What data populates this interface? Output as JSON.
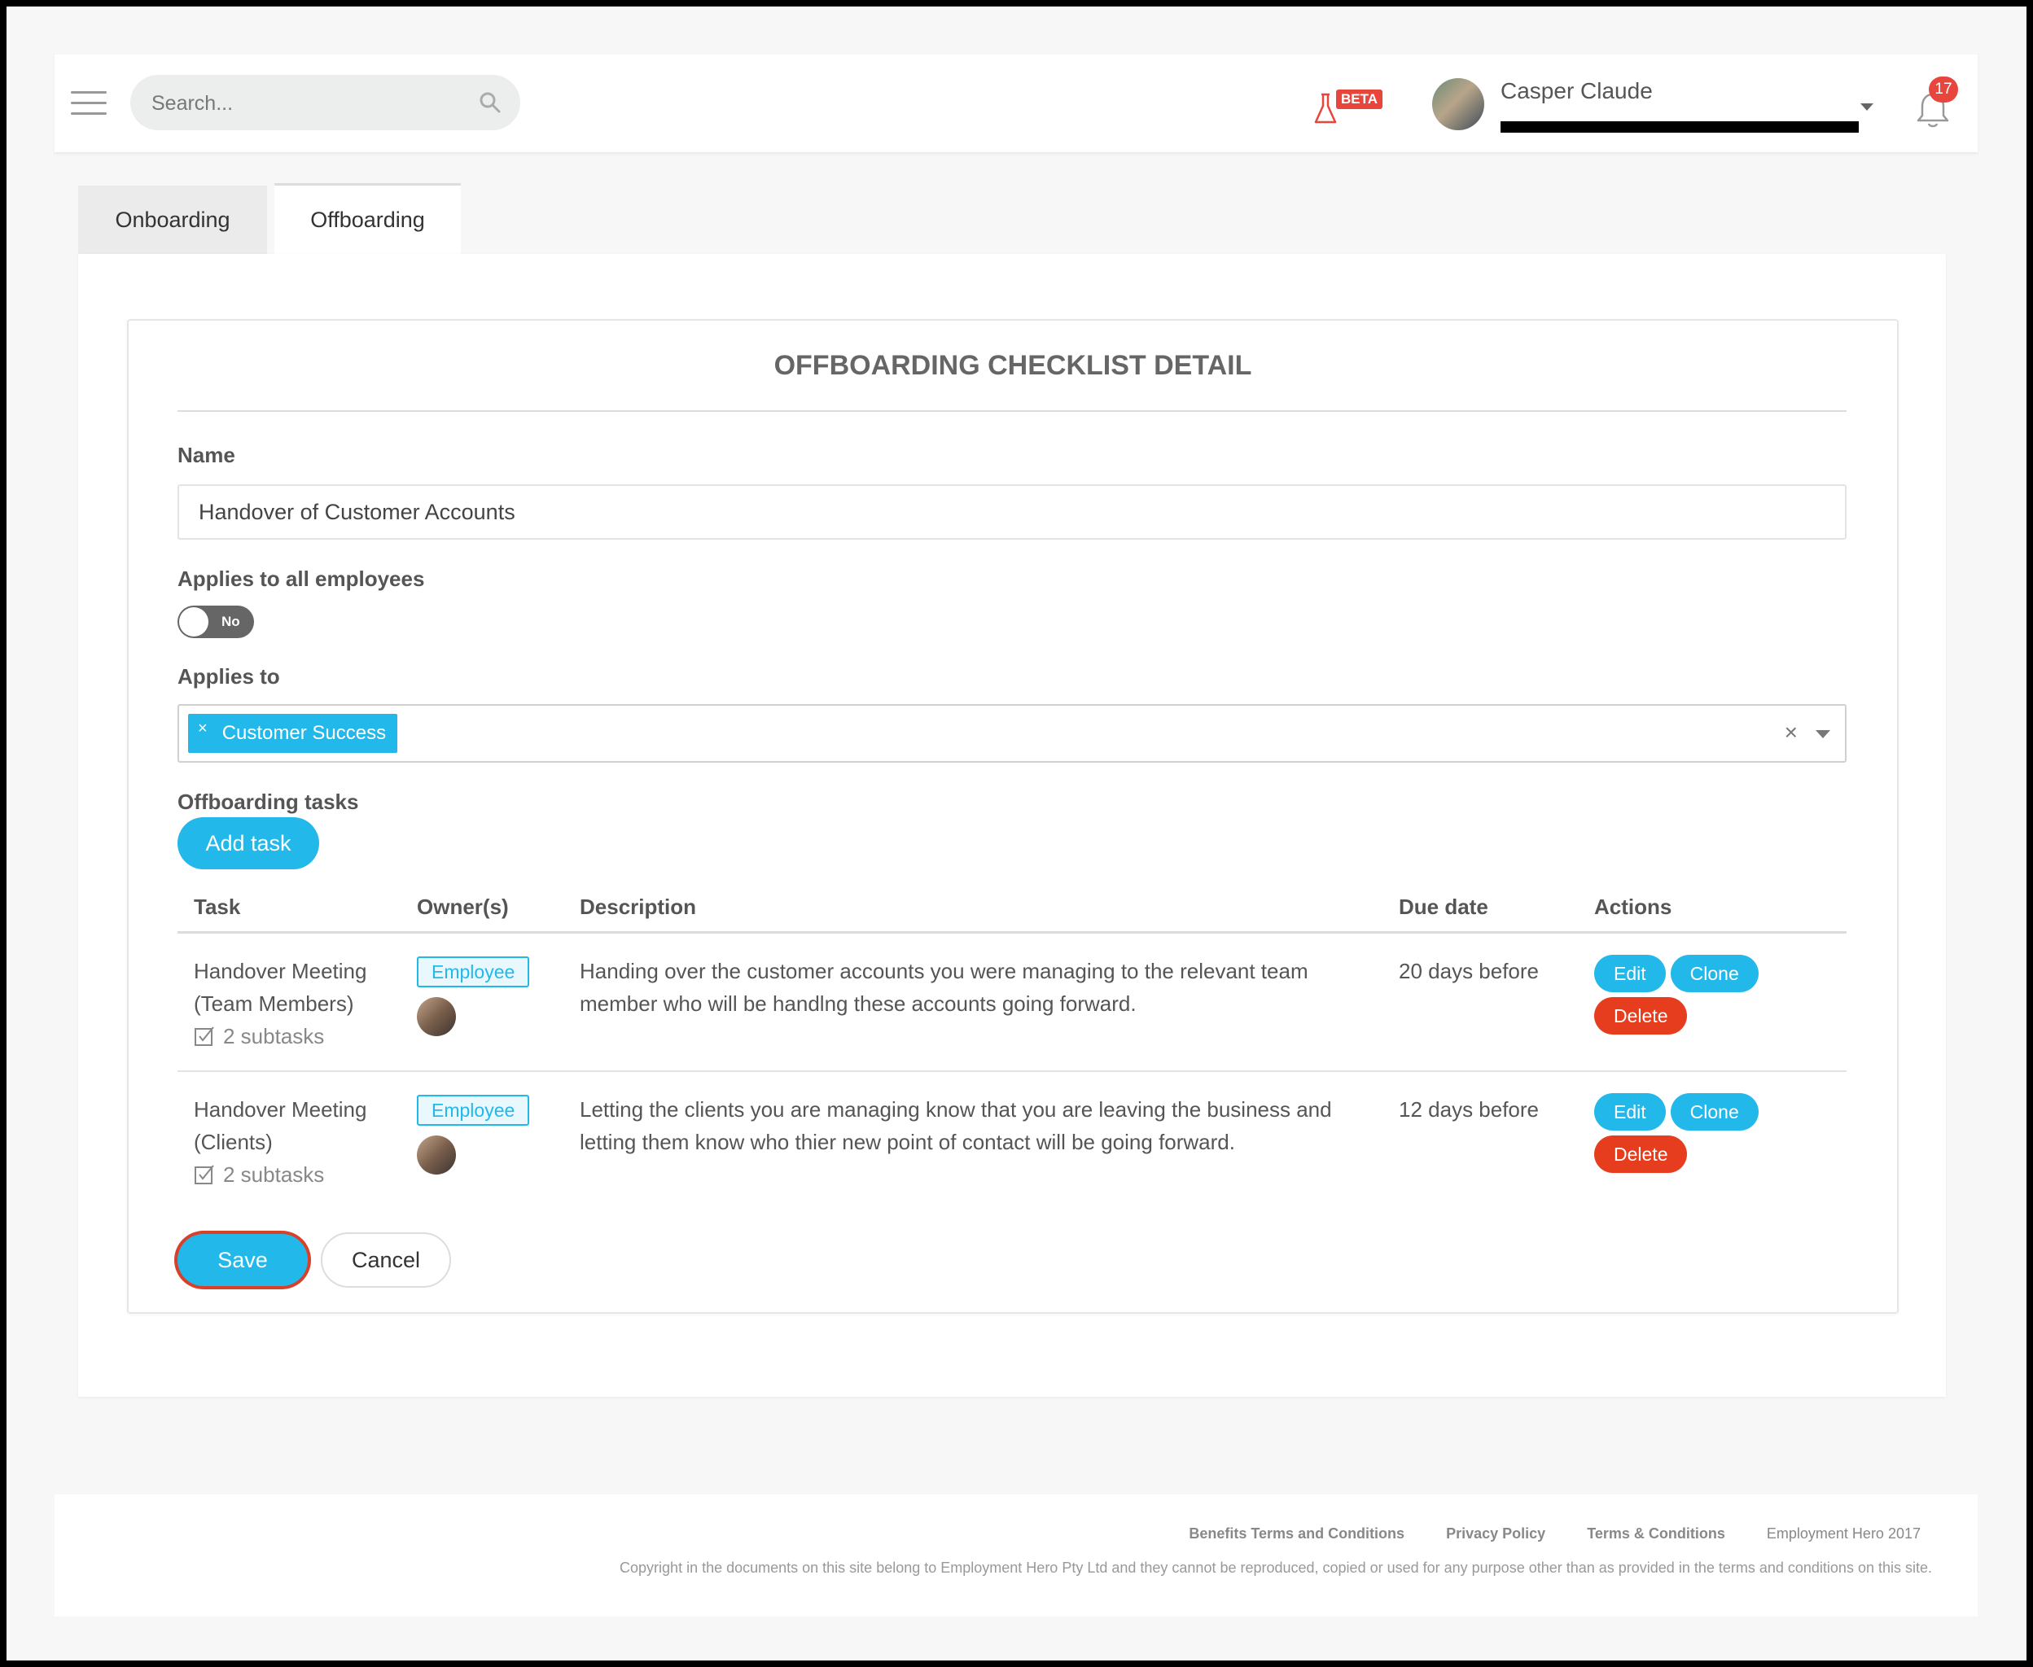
{
  "header": {
    "search_placeholder": "Search...",
    "beta_label": "BETA",
    "user_name": "Casper Claude",
    "notification_count": "17"
  },
  "tabs": [
    {
      "label": "Onboarding",
      "active": false
    },
    {
      "label": "Offboarding",
      "active": true
    }
  ],
  "card": {
    "title": "OFFBOARDING CHECKLIST DETAIL",
    "name_label": "Name",
    "name_value": "Handover of Customer Accounts",
    "applies_all_label": "Applies to all employees",
    "applies_all_toggle": "No",
    "applies_to_label": "Applies to",
    "applies_to_chip_remove": "×",
    "applies_to_chip": "Customer Success",
    "applies_to_clear": "×",
    "tasks_label": "Offboarding tasks",
    "add_task_label": "Add task"
  },
  "table": {
    "columns": [
      "Task",
      "Owner(s)",
      "Description",
      "Due date",
      "Actions"
    ],
    "rows": [
      {
        "task": "Handover Meeting (Team Members)",
        "subtasks": "2 subtasks",
        "owner": "Employee",
        "description": "Handing over the customer accounts you were managing to the relevant team member who will be handlng these accounts going forward.",
        "due": "20 days before"
      },
      {
        "task": "Handover Meeting (Clients)",
        "subtasks": "2 subtasks",
        "owner": "Employee",
        "description": "Letting the clients you are managing know that you are leaving the business and letting them know who thier new point of contact will be going forward.",
        "due": "12 days before"
      }
    ],
    "actions": {
      "edit": "Edit",
      "clone": "Clone",
      "delete": "Delete"
    }
  },
  "form_actions": {
    "save": "Save",
    "cancel": "Cancel"
  },
  "footer": {
    "links": [
      "Benefits Terms and Conditions",
      "Privacy Policy",
      "Terms & Conditions"
    ],
    "brand": "Employment Hero 2017",
    "copyright": "Copyright in the documents on this site belong to Employment Hero Pty Ltd and they cannot be reproduced, copied or used for any purpose other than as provided in the terms and conditions on this site."
  },
  "colors": {
    "accent": "#22b8ea",
    "danger": "#e63d1e",
    "badge": "#e8453c"
  }
}
